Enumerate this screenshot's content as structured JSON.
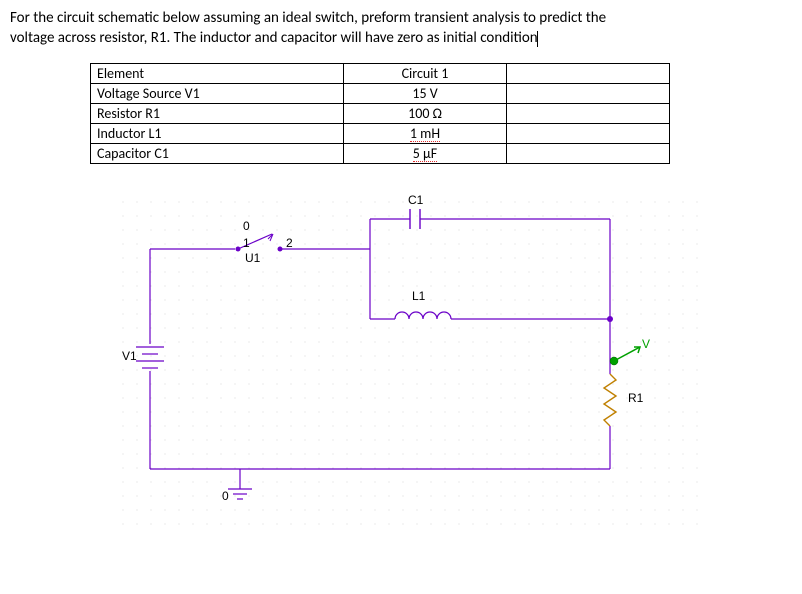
{
  "problem": {
    "line1": "For the circuit schematic below assuming an ideal switch, preform transient analysis to predict the",
    "line2": "voltage across resistor, R1. The inductor and capacitor will have zero as initial condition"
  },
  "table": {
    "headers": {
      "c1": "Element",
      "c2": "Circuit 1",
      "c3": ""
    },
    "rows": [
      {
        "c1": "Voltage Source V1",
        "c2": "15 V",
        "c3": ""
      },
      {
        "c1": "Resistor R1",
        "c2": "100 Ω",
        "c3": ""
      },
      {
        "c1": "Inductor L1",
        "c2": "1 mH",
        "c3": "",
        "err": true
      },
      {
        "c1": "Capacitor C1",
        "c2": "5 μF",
        "c3": "",
        "err": true
      }
    ]
  },
  "circuit": {
    "labels": {
      "V1": "V1",
      "U1": "U1",
      "sw0": "0",
      "sw1": "1",
      "sw2": "2",
      "C1": "C1",
      "L1": "L1",
      "R1": "R1",
      "gnd0": "0",
      "probeV": "V"
    }
  }
}
